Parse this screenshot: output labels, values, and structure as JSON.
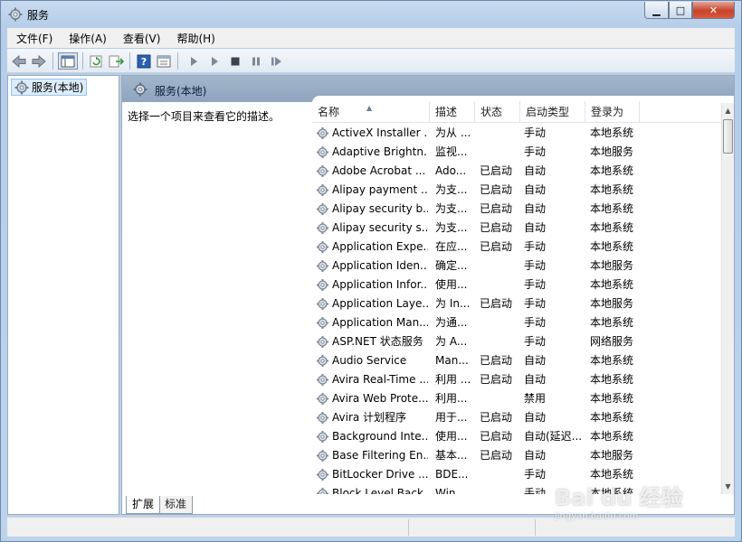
{
  "window": {
    "title": "服务"
  },
  "menu": [
    {
      "label": "文件(F)"
    },
    {
      "label": "操作(A)"
    },
    {
      "label": "查看(V)"
    },
    {
      "label": "帮助(H)"
    }
  ],
  "toolbar": {
    "icons": [
      "back-arrow-icon",
      "forward-arrow-icon",
      "console-tree-icon",
      "refresh-icon",
      "export-list-icon",
      "help-icon",
      "properties-icon",
      "start-service-icon",
      "start-service-alt-icon",
      "stop-service-icon",
      "pause-service-icon",
      "restart-service-icon"
    ]
  },
  "tree": {
    "root_label": "服务(本地)"
  },
  "details": {
    "header_title": "服务(本地)",
    "description_hint": "选择一个项目来查看它的描述。",
    "columns": {
      "name": "名称",
      "desc": "描述",
      "status": "状态",
      "startup": "启动类型",
      "logon": "登录为"
    }
  },
  "services": [
    {
      "name": "ActiveX Installer ...",
      "desc": "为从 ...",
      "status": "",
      "startup": "手动",
      "logon": "本地系统"
    },
    {
      "name": "Adaptive Brightn...",
      "desc": "监视...",
      "status": "",
      "startup": "手动",
      "logon": "本地服务"
    },
    {
      "name": "Adobe Acrobat ...",
      "desc": "Ado...",
      "status": "已启动",
      "startup": "自动",
      "logon": "本地系统"
    },
    {
      "name": "Alipay payment ...",
      "desc": "为支...",
      "status": "已启动",
      "startup": "自动",
      "logon": "本地系统"
    },
    {
      "name": "Alipay security b...",
      "desc": "为支...",
      "status": "已启动",
      "startup": "自动",
      "logon": "本地系统"
    },
    {
      "name": "Alipay security s...",
      "desc": "为支...",
      "status": "已启动",
      "startup": "自动",
      "logon": "本地系统"
    },
    {
      "name": "Application Expe...",
      "desc": "在应...",
      "status": "已启动",
      "startup": "手动",
      "logon": "本地系统"
    },
    {
      "name": "Application Iden...",
      "desc": "确定...",
      "status": "",
      "startup": "手动",
      "logon": "本地服务"
    },
    {
      "name": "Application Infor...",
      "desc": "使用...",
      "status": "",
      "startup": "手动",
      "logon": "本地系统"
    },
    {
      "name": "Application Laye...",
      "desc": "为 In...",
      "status": "已启动",
      "startup": "手动",
      "logon": "本地服务"
    },
    {
      "name": "Application Man...",
      "desc": "为通...",
      "status": "",
      "startup": "手动",
      "logon": "本地系统"
    },
    {
      "name": "ASP.NET 状态服务",
      "desc": "为 A...",
      "status": "",
      "startup": "手动",
      "logon": "网络服务"
    },
    {
      "name": "Audio Service",
      "desc": "Man...",
      "status": "已启动",
      "startup": "自动",
      "logon": "本地系统"
    },
    {
      "name": "Avira Real-Time ...",
      "desc": "利用 ...",
      "status": "已启动",
      "startup": "自动",
      "logon": "本地系统"
    },
    {
      "name": "Avira Web Prote...",
      "desc": "利用...",
      "status": "",
      "startup": "禁用",
      "logon": "本地系统"
    },
    {
      "name": "Avira 计划程序",
      "desc": "用于...",
      "status": "已启动",
      "startup": "自动",
      "logon": "本地系统"
    },
    {
      "name": "Background Inte...",
      "desc": "使用...",
      "status": "已启动",
      "startup": "自动(延迟...",
      "logon": "本地系统"
    },
    {
      "name": "Base Filtering En...",
      "desc": "基本...",
      "status": "已启动",
      "startup": "自动",
      "logon": "本地服务"
    },
    {
      "name": "BitLocker Drive ...",
      "desc": "BDE...",
      "status": "",
      "startup": "手动",
      "logon": "本地系统"
    },
    {
      "name": "Block Level Back...",
      "desc": "Win...",
      "status": "",
      "startup": "手动",
      "logon": "本地系统"
    }
  ],
  "tabs": [
    {
      "label": "扩展"
    },
    {
      "label": "标准"
    }
  ],
  "watermark": {
    "text": "Bai du 经验",
    "sub": "jingyan.baidu.com"
  },
  "colors": {
    "header_bar": "#94a9c2",
    "selection": "#dcecfb",
    "window_frame": "#b9d1ea"
  }
}
